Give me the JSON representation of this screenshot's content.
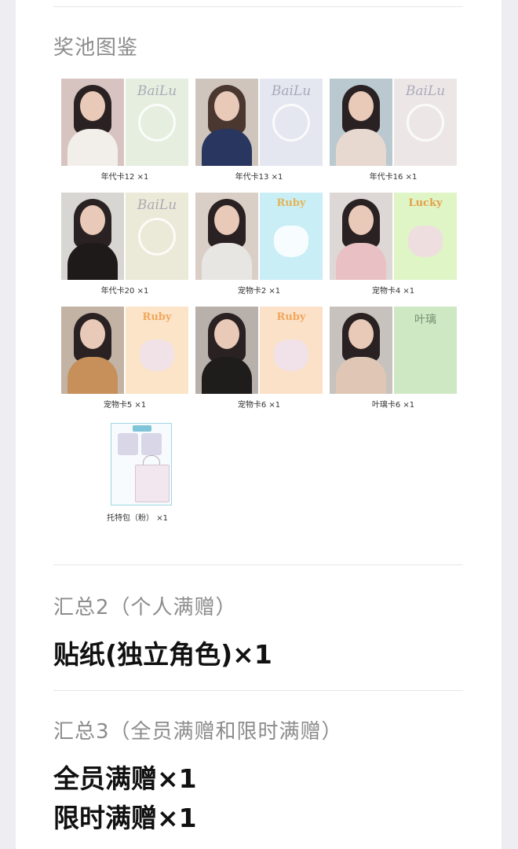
{
  "prize_pool": {
    "title": "奖池图鉴",
    "items": [
      {
        "caption": "年代卡12 ×1",
        "photo_colors": [
          "#d7c4c0",
          "#f2efeb"
        ],
        "art_color": "#e5eedf",
        "art_text": "BaiLu"
      },
      {
        "caption": "年代卡13 ×1",
        "photo_colors": [
          "#cfc5bc",
          "#283660"
        ],
        "art_color": "#e4e7ef",
        "art_text": "BaiLu"
      },
      {
        "caption": "年代卡16 ×1",
        "photo_colors": [
          "#b9c9cf",
          "#e8d9d0"
        ],
        "art_color": "#ece7e6",
        "art_text": "BaiLu"
      },
      {
        "caption": "年代卡20 ×1",
        "photo_colors": [
          "#d8d6d3",
          "#1e1a1a"
        ],
        "art_color": "#ebe9d7",
        "art_text": "BaiLu"
      },
      {
        "caption": "宠物卡2 ×1",
        "photo_colors": [
          "#d9cfc7",
          "#e8e6e3"
        ],
        "art_color": "#c9eef5",
        "art_text": "Ruby"
      },
      {
        "caption": "宠物卡4 ×1",
        "photo_colors": [
          "#ddd8d6",
          "#e9c0c4"
        ],
        "art_color": "#dff5c6",
        "art_text": "Lucky"
      },
      {
        "caption": "宠物卡5 ×1",
        "photo_colors": [
          "#c2b3a5",
          "#c7905a"
        ],
        "art_color": "#fbe4c7",
        "art_text": "Ruby"
      },
      {
        "caption": "宠物卡6 ×1",
        "photo_colors": [
          "#b8b1ab",
          "#1f1c1c"
        ],
        "art_color": "#fbe1c8",
        "art_text": "Ruby"
      },
      {
        "caption": "叶璃卡6 ×1",
        "photo_colors": [
          "#c7c2bd",
          "#e0c7b5"
        ],
        "art_color": "#cfe8c4",
        "art_text": "叶璃"
      }
    ],
    "bag": {
      "caption": "托特包（粉） ×1"
    }
  },
  "summary2": {
    "title": "汇总2（个人满赠）",
    "line": "贴纸(独立角色)×1"
  },
  "summary3": {
    "title": "汇总3（全员满赠和限时满赠）",
    "lines": [
      "全员满赠×1",
      "限时满赠×1"
    ]
  }
}
